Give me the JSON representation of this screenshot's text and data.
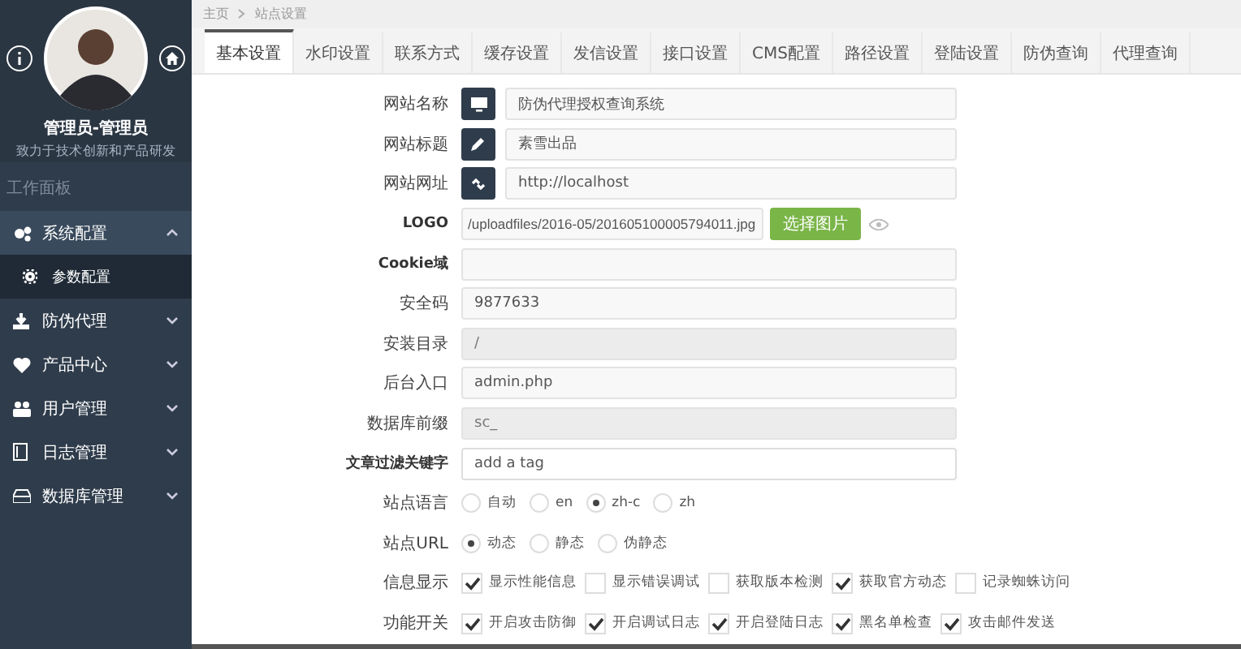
{
  "breadcrumb": [
    {
      "label": "主页"
    },
    {
      "label": "站点设置"
    }
  ],
  "sidebar": {
    "user_name": "管理员-管理员",
    "user_motto": "致力于技术创新和产品研发",
    "section": "工作面板",
    "items": [
      {
        "label": "系统配置",
        "selected": true,
        "expanded": true,
        "children": [
          {
            "label": "参数配置"
          }
        ]
      },
      {
        "label": "防伪代理",
        "selected": false,
        "expanded": false
      },
      {
        "label": "产品中心",
        "selected": false,
        "expanded": false
      },
      {
        "label": "用户管理",
        "selected": false,
        "expanded": false
      },
      {
        "label": "日志管理",
        "selected": false,
        "expanded": false
      },
      {
        "label": "数据库管理",
        "selected": false,
        "expanded": false
      }
    ]
  },
  "tabs": [
    {
      "label": "基本设置",
      "selected": true
    },
    {
      "label": "水印设置",
      "selected": false
    },
    {
      "label": "联系方式",
      "selected": false
    },
    {
      "label": "缓存设置",
      "selected": false
    },
    {
      "label": "发信设置",
      "selected": false
    },
    {
      "label": "接口设置",
      "selected": false
    },
    {
      "label": "CMS配置",
      "selected": false
    },
    {
      "label": "路径设置",
      "selected": false
    },
    {
      "label": "登陆设置",
      "selected": false
    },
    {
      "label": "防伪查询",
      "selected": false
    },
    {
      "label": "代理查询",
      "selected": false
    }
  ],
  "form": [
    {
      "kind": "addon",
      "label": "网站名称",
      "value": "防伪代理授权查询系统"
    },
    {
      "kind": "addon",
      "label": "网站标题",
      "value": "素雪出品"
    },
    {
      "kind": "addon",
      "label": "网站网址",
      "value": "http://localhost"
    },
    {
      "kind": "upload",
      "label": "LOGO",
      "value": "/uploadfiles/2016-05/201605100005794011.jpg",
      "button": "选择图片"
    },
    {
      "kind": "input",
      "label": "Cookie域",
      "disabled": false
    },
    {
      "kind": "input",
      "label": "安全码",
      "value": "9877633",
      "disabled": false
    },
    {
      "kind": "input",
      "label": "安装目录",
      "value": "/",
      "disabled": true
    },
    {
      "kind": "input",
      "label": "后台入口",
      "value": "admin.php",
      "disabled": false
    },
    {
      "kind": "input",
      "label": "数据库前缀",
      "value": "sc_",
      "disabled": true
    },
    {
      "kind": "tags",
      "label": "文章过滤关键字",
      "placeholder": "add a tag"
    },
    {
      "kind": "radio",
      "label": "站点语言",
      "options": [
        {
          "label": "自动",
          "selected": false
        },
        {
          "label": "en",
          "selected": false
        },
        {
          "label": "zh-c",
          "selected": true
        },
        {
          "label": "zh",
          "selected": false
        }
      ]
    },
    {
      "kind": "radio",
      "label": "站点URL",
      "options": [
        {
          "label": "动态",
          "selected": true
        },
        {
          "label": "静态",
          "selected": false
        },
        {
          "label": "伪静态",
          "selected": false
        }
      ]
    },
    {
      "kind": "checkbox",
      "label": "信息显示",
      "options": [
        {
          "label": "显示性能信息",
          "checked": true
        },
        {
          "label": "显示错误调试",
          "checked": false
        },
        {
          "label": "获取版本检测",
          "checked": false
        },
        {
          "label": "获取官方动态",
          "checked": true
        },
        {
          "label": "记录蜘蛛访问",
          "checked": false
        }
      ]
    },
    {
      "kind": "checkbox",
      "label": "功能开关",
      "options": [
        {
          "label": "开启攻击防御",
          "checked": true
        },
        {
          "label": "开启调试日志",
          "checked": true
        },
        {
          "label": "开启登陆日志",
          "checked": true
        },
        {
          "label": "黑名单检查",
          "checked": true
        },
        {
          "label": "攻击邮件发送",
          "checked": true
        }
      ]
    }
  ]
}
